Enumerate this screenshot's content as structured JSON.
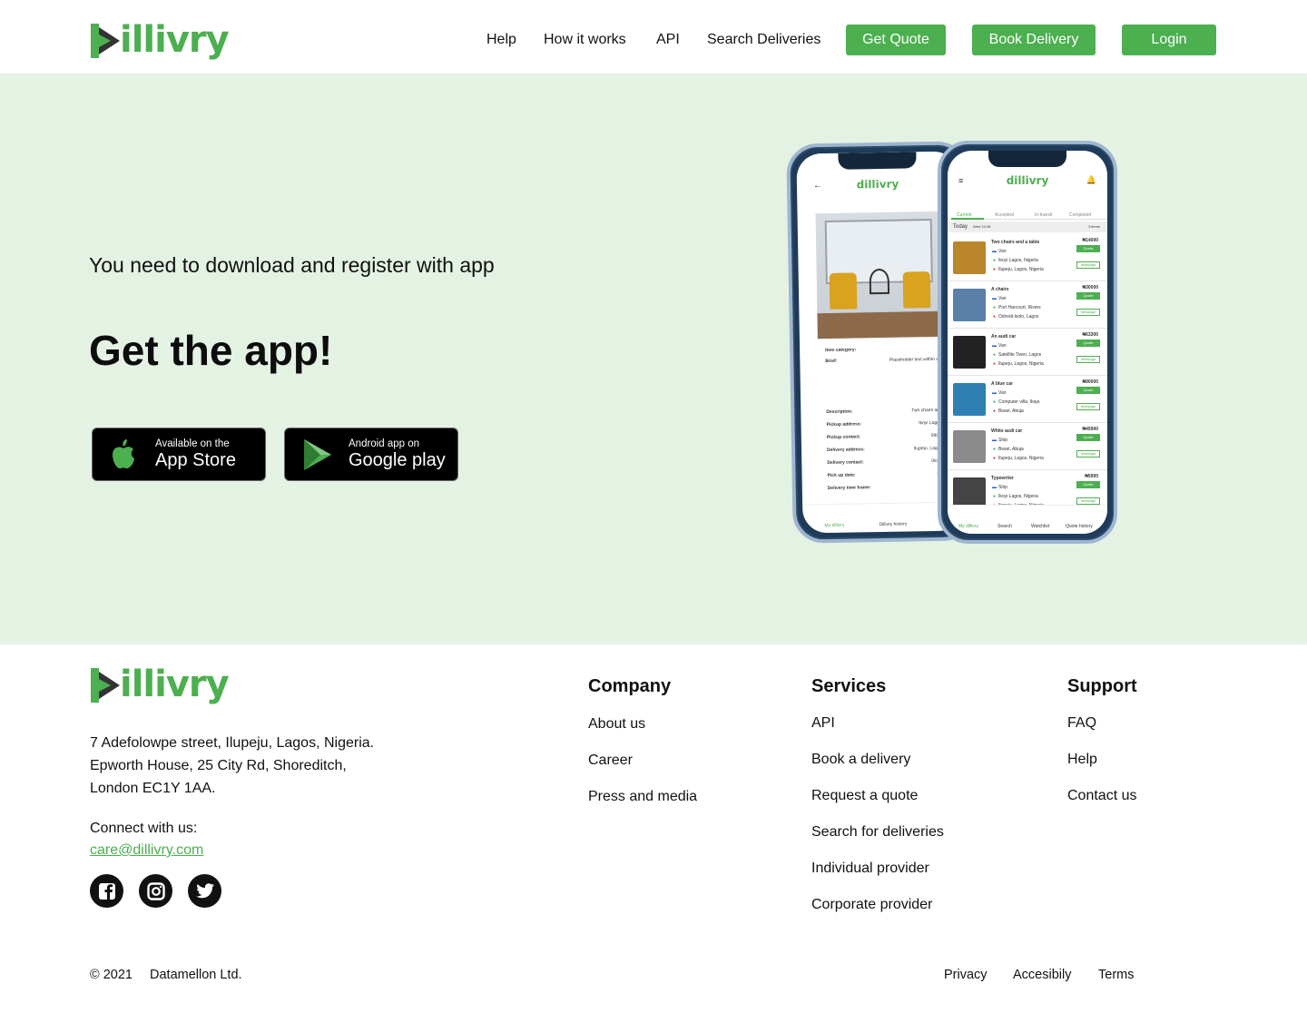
{
  "brand": {
    "name": "dillivry",
    "logo_word": "illivry",
    "accent_color": "#4caf50",
    "mark_dark_color": "#333333"
  },
  "header": {
    "nav": [
      "Help",
      "How it works",
      "API",
      "Search Deliveries"
    ],
    "buttons": [
      "Get Quote",
      "Book Delivery",
      "Login"
    ]
  },
  "hero": {
    "background": "#e4f2e4",
    "subtitle": "You need to download and register with app",
    "title": "Get the app!",
    "app_store": {
      "small": "Available on the",
      "big": "App Store",
      "icon": "apple-icon"
    },
    "google_play": {
      "small": "Android app on",
      "big": "Google play",
      "icon": "google-play-icon"
    }
  },
  "phone_left": {
    "logo": "dillivry",
    "fields": [
      {
        "label": "Item category:",
        "value": "Furnit"
      },
      {
        "label": "Brief:",
        "value": "Placeholder text within a form fi"
      },
      {
        "label": "Description:",
        "value": "Two chairs and a tab"
      },
      {
        "label": "Pickup address:",
        "value": "Ikoyi Lagos, Nige"
      },
      {
        "label": "Pickup contact:",
        "value": "0906 543 2"
      },
      {
        "label": "Delivery address:",
        "value": "Ilupeju, Lagos, Nige"
      },
      {
        "label": "Delivery contact:",
        "value": "0818 700 6"
      },
      {
        "label": "Pick up date:",
        "value": "11-09-20"
      },
      {
        "label": "Delivery time frame:",
        "value": ""
      }
    ],
    "tabs": [
      "My dillivry",
      "Dillivry history",
      "Pr"
    ]
  },
  "phone_right": {
    "logo": "dillivry",
    "tabs": [
      "Current",
      "Accepted",
      "In-transit",
      "Completed"
    ],
    "today": "Today",
    "date": "Wed 15.09.",
    "count": "3 items",
    "items": [
      {
        "title": "Two chairs and a table",
        "mode": "Van",
        "from": "Ikoyi Lagos, Nigeria",
        "to": "Ilupeju, Lagos, Nigeria",
        "price": "₦14000",
        "thumb": "#b9862a"
      },
      {
        "title": "A chairs",
        "mode": "Van",
        "from": "Port Harcourt, Rivers",
        "to": "Oshodi-Isolo, Lagos",
        "price": "₦30000",
        "thumb": "#5a7fa8"
      },
      {
        "title": "An audi car",
        "mode": "Van",
        "from": "Satellite Town, Lagos",
        "to": "Ilupeju, Lagos, Nigeria",
        "price": "₦63300",
        "thumb": "#222222"
      },
      {
        "title": "A blue car",
        "mode": "Van",
        "from": "Computer villa, Ikeja",
        "to": "Bwari, Abuja",
        "price": "₦90000",
        "thumb": "#2d7fb4"
      },
      {
        "title": "White audi car",
        "mode": "Ship",
        "from": "Bwari, Abuja",
        "to": "Ilupeju, Lagos, Nigeria",
        "price": "₦45900",
        "thumb": "#8a8a8a"
      },
      {
        "title": "Typewriter",
        "mode": "Ship",
        "from": "Ikoyi Lagos, Nigeria",
        "to": "Ilupeju, Lagos, Nigeria",
        "price": "₦5900",
        "thumb": "#444444"
      }
    ],
    "quote_label": "Quote",
    "message_label": "Message",
    "bottom_tabs": [
      "My dillivry",
      "Search",
      "Watchlist",
      "Quote history"
    ]
  },
  "footer": {
    "address_lines": [
      "7 Adefolowpe street, Ilupeju, Lagos, Nigeria.",
      "Epworth House, 25 City Rd, Shoreditch,",
      "London EC1Y 1AA."
    ],
    "connect_label": "Connect with us:",
    "email": "care@dillivry.com",
    "social": [
      "facebook-icon",
      "instagram-icon",
      "twitter-icon"
    ],
    "company": {
      "heading": "Company",
      "links": [
        "About us",
        "Career",
        "Press and media"
      ]
    },
    "services": {
      "heading": "Services",
      "links": [
        "API",
        "Book a delivery",
        "Request a quote",
        "Search for deliveries",
        "Individual provider",
        "Corporate provider"
      ]
    },
    "support": {
      "heading": "Support",
      "links": [
        "FAQ",
        "Help",
        "Contact us"
      ]
    },
    "copyright": "© 2021",
    "company_name": "Datamellon Ltd.",
    "legal": [
      "Privacy",
      "Accesibily",
      "Terms"
    ]
  }
}
